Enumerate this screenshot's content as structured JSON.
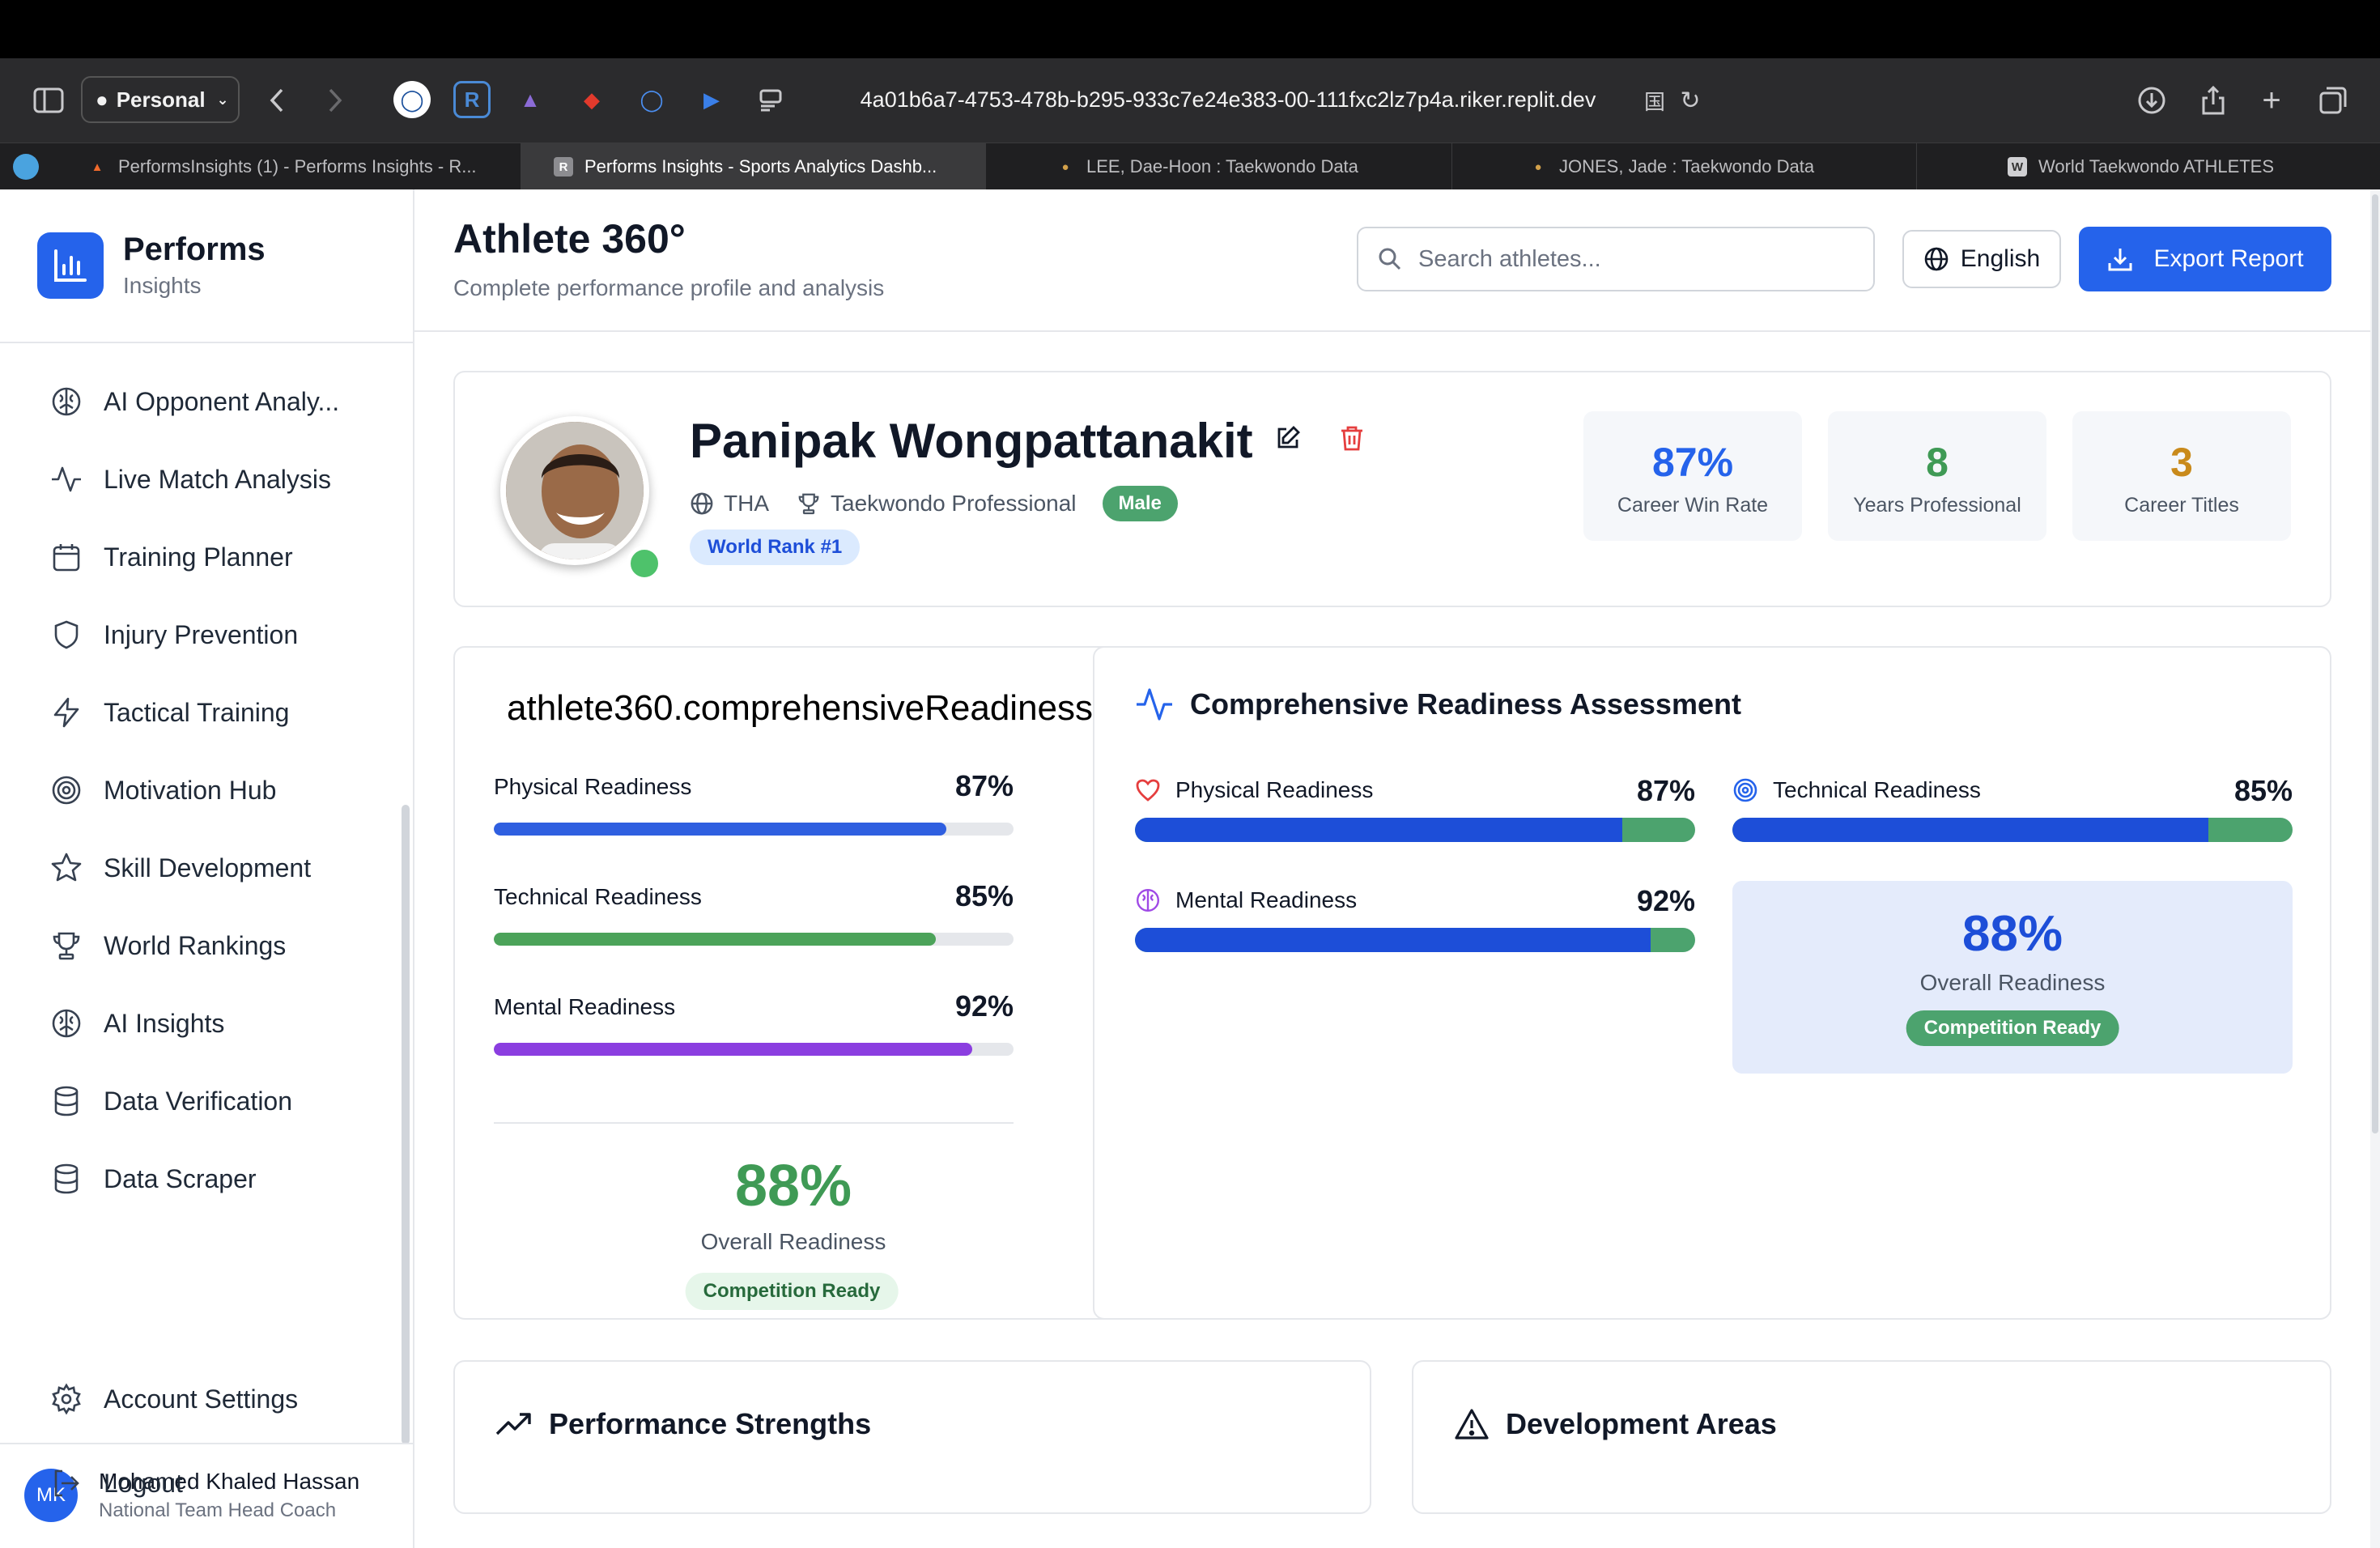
{
  "browser": {
    "profile": "Personal",
    "url": "4a01b6a7-4753-478b-b295-933c7e24e383-00-111fxc2lz7p4a.riker.replit.dev",
    "tabs": [
      {
        "label": "PerformsInsights (1) - Performs Insights - R...",
        "active": false
      },
      {
        "label": "Performs Insights - Sports Analytics Dashb...",
        "active": true
      },
      {
        "label": "LEE, Dae-Hoon : Taekwondo Data",
        "active": false
      },
      {
        "label": "JONES, Jade : Taekwondo Data",
        "active": false
      },
      {
        "label": "World Taekwondo ATHLETES",
        "active": false
      }
    ]
  },
  "sidebar": {
    "brand_name": "Performs",
    "brand_sub": "Insights",
    "items": [
      {
        "label": "AI Opponent Analy...",
        "icon": "brain-icon"
      },
      {
        "label": "Live Match Analysis",
        "icon": "activity-icon"
      },
      {
        "label": "Training Planner",
        "icon": "calendar-icon"
      },
      {
        "label": "Injury Prevention",
        "icon": "shield-icon"
      },
      {
        "label": "Tactical Training",
        "icon": "zap-icon"
      },
      {
        "label": "Motivation Hub",
        "icon": "target-icon"
      },
      {
        "label": "Skill Development",
        "icon": "star-icon"
      },
      {
        "label": "World Rankings",
        "icon": "trophy-icon"
      },
      {
        "label": "AI Insights",
        "icon": "brain-icon"
      },
      {
        "label": "Data Verification",
        "icon": "database-icon"
      },
      {
        "label": "Data Scraper",
        "icon": "database-icon"
      }
    ],
    "user": {
      "initials": "MK",
      "name": "Mohamed Khaled Hassan",
      "role": "National Team Head Coach"
    },
    "account_settings": "Account Settings",
    "logout": "Logout"
  },
  "header": {
    "title": "Athlete 360°",
    "subtitle": "Complete performance profile and analysis",
    "search_placeholder": "Search athletes...",
    "language": "English",
    "export_label": "Export Report"
  },
  "athlete": {
    "name": "Panipak Wongpattanakit",
    "country": "THA",
    "discipline": "Taekwondo Professional",
    "gender": "Male",
    "rank": "World Rank #1",
    "stats": [
      {
        "value": "87%",
        "label": "Career Win Rate",
        "color": "#2563eb"
      },
      {
        "value": "8",
        "label": "Years Professional",
        "color": "#3f9a55"
      },
      {
        "value": "3",
        "label": "Career Titles",
        "color": "#c98a1b"
      }
    ]
  },
  "readiness_left": {
    "title": "athlete360.comprehensiveReadiness",
    "items": [
      {
        "label": "Physical Readiness",
        "value": "87%",
        "pct": 87,
        "color": "#2f5fe0"
      },
      {
        "label": "Technical Readiness",
        "value": "85%",
        "pct": 85,
        "color": "#4ca35a"
      },
      {
        "label": "Mental Readiness",
        "value": "92%",
        "pct": 92,
        "color": "#8b3ee0"
      }
    ],
    "overall_value": "88%",
    "overall_label": "Overall Readiness",
    "status": "Competition Ready"
  },
  "readiness_right": {
    "title": "Comprehensive Readiness Assessment",
    "items": [
      {
        "label": "Physical Readiness",
        "value": "87%",
        "pct": 87,
        "icon": "heart-icon"
      },
      {
        "label": "Technical Readiness",
        "value": "85%",
        "pct": 85,
        "icon": "target-icon"
      },
      {
        "label": "Mental Readiness",
        "value": "92%",
        "pct": 92,
        "icon": "brain-icon"
      }
    ],
    "overall_value": "88%",
    "overall_label": "Overall Readiness",
    "status": "Competition Ready"
  },
  "sections": {
    "strengths": "Performance Strengths",
    "development": "Development Areas"
  }
}
